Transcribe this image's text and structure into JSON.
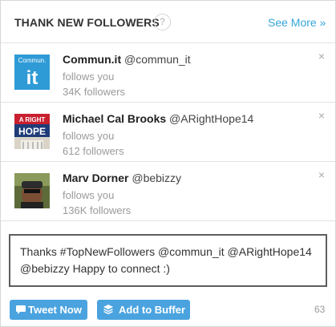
{
  "header": {
    "title": "THANK NEW FOLLOWERS",
    "help_glyph": "?",
    "see_more": "See More »"
  },
  "followers": [
    {
      "name": "Commun.it",
      "handle": "@commun_it",
      "relation": "follows you",
      "followers": "34K followers",
      "avatar_text": "Commun.",
      "avatar_mark": "it"
    },
    {
      "name": "Michael Cal Brooks",
      "handle": "@ARightHope14",
      "relation": "follows you",
      "followers": "612 followers",
      "avatar_text": "A RIGHT",
      "avatar_mark": "HOPE"
    },
    {
      "name": "Marv Dorner",
      "handle": "@bebizzy",
      "relation": "follows you",
      "followers": "136K followers"
    }
  ],
  "close_glyph": "×",
  "compose": {
    "text": "Thanks #TopNewFollowers @commun_it @ARightHope14 @bebizzy Happy to connect :)",
    "remaining": "63"
  },
  "buttons": {
    "tweet": "Tweet Now",
    "buffer": "Add to Buffer"
  },
  "colors": {
    "accent": "#4aa3df",
    "link": "#35a5d8"
  },
  "icons": [
    "help-icon",
    "close-icon",
    "speech-bubble-icon",
    "buffer-stack-icon"
  ]
}
